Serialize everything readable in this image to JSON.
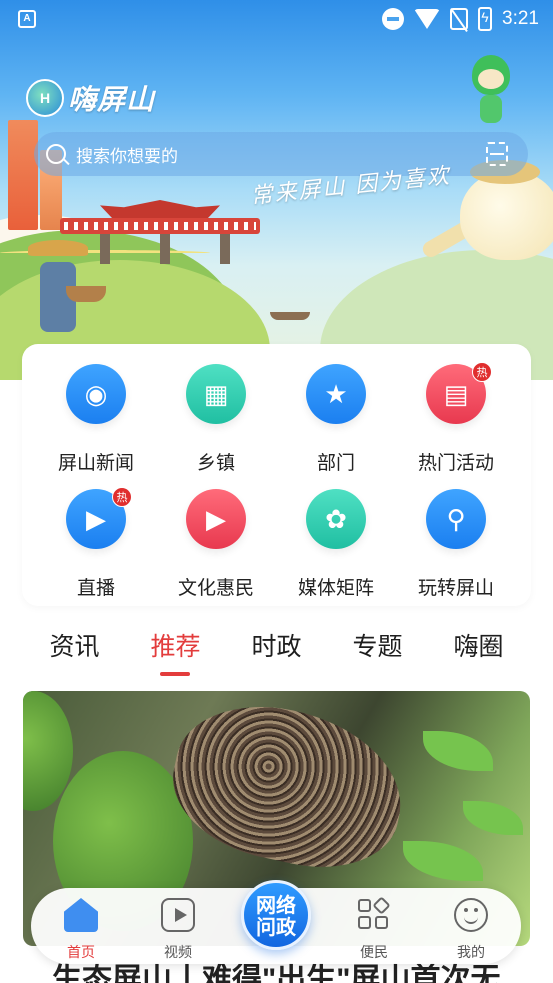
{
  "status_bar": {
    "time": "3:21"
  },
  "header": {
    "app_name": "嗨屏山",
    "slogan": "常来屏山 因为喜欢"
  },
  "search": {
    "placeholder": "搜索你想要的"
  },
  "grid": {
    "items": [
      {
        "label": "屏山新闻",
        "icon": "camera-icon",
        "color": "#1b7ff0",
        "hot": false
      },
      {
        "label": "乡镇",
        "icon": "building-icon",
        "color": "#20bfa2",
        "hot": false
      },
      {
        "label": "部门",
        "icon": "government-icon",
        "color": "#1b7ff0",
        "hot": false
      },
      {
        "label": "热门活动",
        "icon": "gift-icon",
        "color": "#e8394f",
        "hot": true
      },
      {
        "label": "直播",
        "icon": "live-icon",
        "color": "#1b7ff0",
        "hot": true
      },
      {
        "label": "文化惠民",
        "icon": "film-icon",
        "color": "#e8394f",
        "hot": false
      },
      {
        "label": "媒体矩阵",
        "icon": "clover-icon",
        "color": "#20bfa2",
        "hot": false
      },
      {
        "label": "玩转屏山",
        "icon": "map-pin-icon",
        "color": "#1b7ff0",
        "hot": false
      }
    ],
    "hot_badge": "热"
  },
  "tabs": {
    "items": [
      "资讯",
      "推荐",
      "时政",
      "专题",
      "嗨圈"
    ],
    "active_index": 1
  },
  "feature": {
    "caption": "生态屏山丨难得\"出生\"屏山首次无"
  },
  "bottom_nav": {
    "items": [
      {
        "label": "首页",
        "icon": "home-icon",
        "active": true
      },
      {
        "label": "视频",
        "icon": "video-icon",
        "active": false
      },
      {
        "label": "便民",
        "icon": "grid-icon",
        "active": false
      },
      {
        "label": "我的",
        "icon": "smile-icon",
        "active": false
      }
    ],
    "center_label_line1": "网络",
    "center_label_line2": "问政"
  },
  "colors": {
    "accent": "#e33c3c",
    "primary_blue": "#1b7ff0"
  }
}
